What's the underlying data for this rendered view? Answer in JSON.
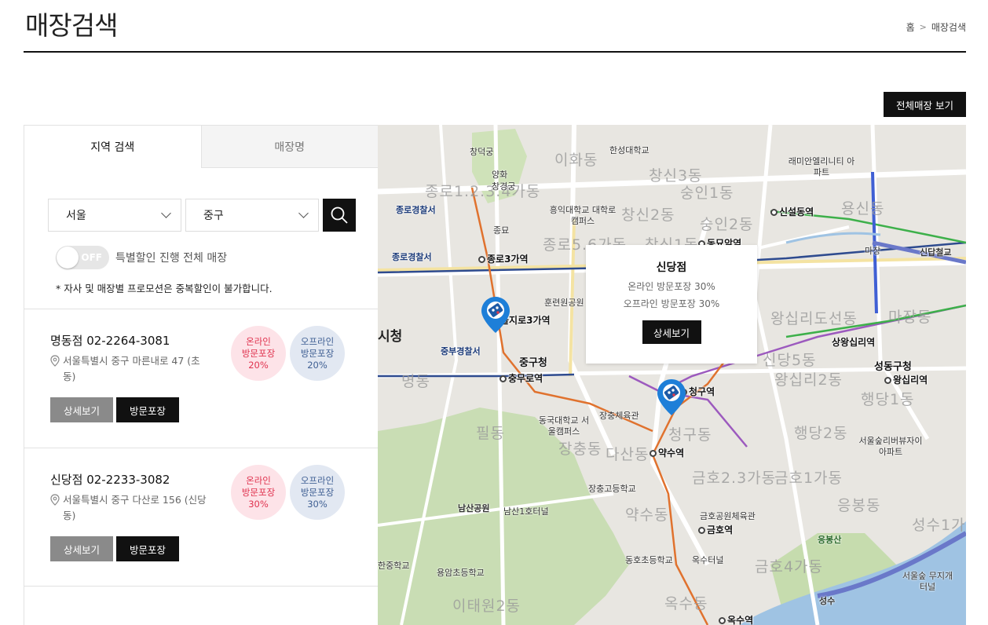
{
  "header": {
    "title": "매장검색",
    "breadcrumb": {
      "home": "홈",
      "separator": ">",
      "current": "매장검색"
    }
  },
  "all_stores_button": "전체매장 보기",
  "tabs": [
    {
      "label": "지역 검색",
      "active": true
    },
    {
      "label": "매장명",
      "active": false
    }
  ],
  "filters": {
    "city": "서울",
    "district": "중구",
    "toggle_state": "OFF",
    "toggle_label": "특별할인 진행 전체 매장",
    "notice": "* 자사 및 매장별 프로모션은 중복할인이 불가합니다."
  },
  "stores": [
    {
      "name": "명동점",
      "phone": "02-2264-3081",
      "address": "서울특별시 중구 마른내로 47 (초동)",
      "online": {
        "line1": "온라인",
        "line2": "방문포장",
        "rate": "20%"
      },
      "offline": {
        "line1": "오프라인",
        "line2": "방문포장",
        "rate": "20%"
      },
      "detail_label": "상세보기",
      "pickup_label": "방문포장"
    },
    {
      "name": "신당점",
      "phone": "02-2233-3082",
      "address": "서울특별시 중구 다산로 156 (신당동)",
      "online": {
        "line1": "온라인",
        "line2": "방문포장",
        "rate": "30%"
      },
      "offline": {
        "line1": "오프라인",
        "line2": "방문포장",
        "rate": "30%"
      },
      "detail_label": "상세보기",
      "pickup_label": "방문포장"
    }
  ],
  "map": {
    "popup": {
      "name": "신당점",
      "online": "온라인 방문포장 30%",
      "offline": "오프라인 방문포장 30%",
      "button": "상세보기"
    },
    "stations": [
      "종로3가역",
      "동묘앞역",
      "신설동역",
      "을지로3가역",
      "충무로역",
      "청구역",
      "약수역",
      "금호역",
      "옥수역",
      "왕십리역"
    ],
    "places": [
      "창덕궁",
      "양화",
      "창경궁",
      "종묘",
      "한성대학교",
      "흥익대학교 대학로캠퍼스",
      "래미안엘리니티 아파트",
      "훈련원공원",
      "중구청",
      "동국대학교 서울캠퍼스",
      "장충체육관",
      "장충고등학교",
      "남산공원",
      "남산1호터널",
      "금호공원체육관",
      "동호초등학교",
      "옥수터널",
      "용암초등학교",
      "서울숲리버뷰자이 아파트",
      "응봉산",
      "서울숲 무지개터널",
      "상왕십리역",
      "성동구청",
      "한중학교",
      "마장",
      "신답철교",
      "성수"
    ],
    "police": [
      "종로경찰서",
      "종로경찰서",
      "중부경찰서"
    ],
    "districts": [
      "이화동",
      "창신3동",
      "숭인1동",
      "종로1.2.3.4가동",
      "창신2동",
      "숭인2동",
      "종로5.6가동",
      "창신1동",
      "용신동",
      "왕십리도선동",
      "마장동",
      "명동",
      "청구동",
      "다산동",
      "필동",
      "장충동",
      "신당5동",
      "왕십리2동",
      "행당1동",
      "행당2동",
      "금호2.3가동",
      "금호1가동",
      "약수동",
      "응봉동",
      "금호4가동",
      "이태원2동",
      "옥수동",
      "성수1가"
    ],
    "city_hall": "시청"
  }
}
